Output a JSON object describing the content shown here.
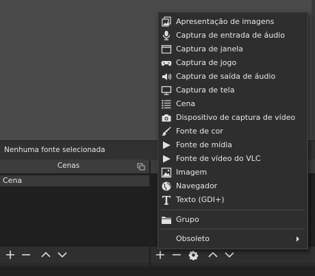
{
  "status": {
    "text": "Nenhuma fonte selecionada"
  },
  "scenes": {
    "title": "Cenas",
    "items": [
      "Cena"
    ]
  },
  "menu": {
    "items": [
      {
        "label": "Apresentação de imagens",
        "icon": "slideshow-icon"
      },
      {
        "label": "Captura de entrada de áudio",
        "icon": "microphone-icon"
      },
      {
        "label": "Captura de janela",
        "icon": "window-icon"
      },
      {
        "label": "Captura de jogo",
        "icon": "gamepad-icon"
      },
      {
        "label": "Captura de saída de áudio",
        "icon": "speaker-icon"
      },
      {
        "label": "Captura de tela",
        "icon": "monitor-icon"
      },
      {
        "label": "Cena",
        "icon": "list-icon"
      },
      {
        "label": "Dispositivo de captura de vídeo",
        "icon": "camera-icon"
      },
      {
        "label": "Fonte de cor",
        "icon": "brush-icon"
      },
      {
        "label": "Fonte de mídia",
        "icon": "play-icon"
      },
      {
        "label": "Fonte de vídeo do VLC",
        "icon": "play-icon"
      },
      {
        "label": "Imagem",
        "icon": "image-icon"
      },
      {
        "label": "Navegador",
        "icon": "globe-icon"
      },
      {
        "label": "Texto (GDI+)",
        "icon": "text-icon"
      },
      {
        "label": "Grupo",
        "icon": "folder-icon"
      },
      {
        "label": "Obsoleto",
        "icon": "chevron-right-icon"
      }
    ]
  }
}
